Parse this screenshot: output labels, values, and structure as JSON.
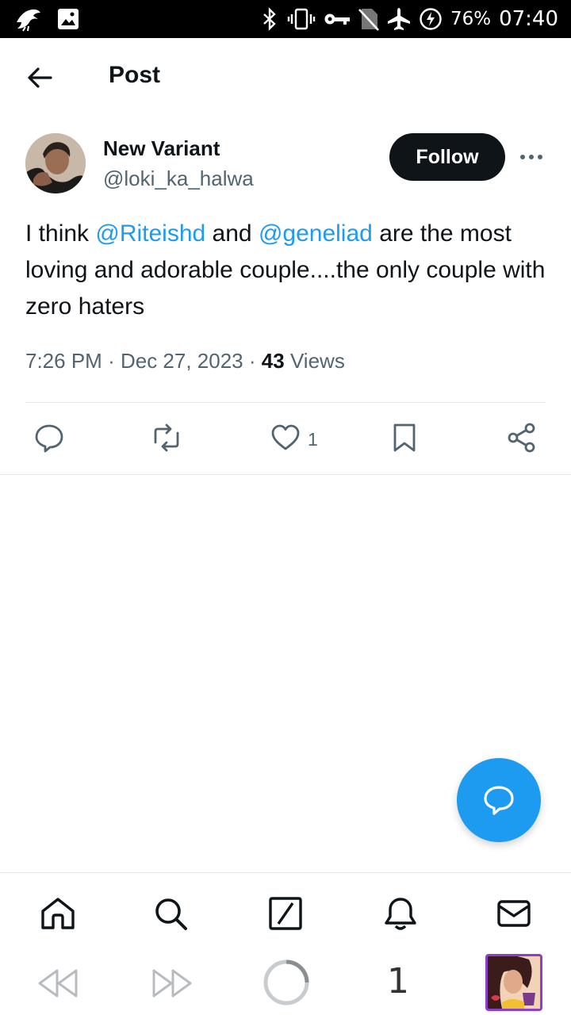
{
  "status_bar": {
    "battery_percent": "76%",
    "time": "07:40",
    "icons": [
      "bird-icon",
      "image-icon",
      "bluetooth-icon",
      "vibrate-icon",
      "key-icon",
      "no-sim-icon",
      "airplane-icon",
      "battery-saver-icon"
    ]
  },
  "header": {
    "title": "Post",
    "back_icon": "arrow-left-icon"
  },
  "post": {
    "author_name": "New Variant",
    "author_handle": "@loki_ka_halwa",
    "follow_label": "Follow",
    "text_parts": {
      "p1": "I think ",
      "m1": "@Riteishd",
      "p2": " and ",
      "m2": "@geneliad",
      "p3": " are the most loving and adorable couple....the only couple with zero haters"
    },
    "time": "7:26 PM",
    "date": "Dec 27, 2023",
    "separator": "·",
    "views_count": "43",
    "views_label": "Views"
  },
  "actions": {
    "reply_icon": "reply-icon",
    "repost_icon": "repost-icon",
    "like_icon": "heart-icon",
    "like_count": "1",
    "bookmark_icon": "bookmark-icon",
    "share_icon": "share-icon"
  },
  "fab": {
    "icon": "compose-reply-icon",
    "color": "#1d9bf0"
  },
  "bottom_nav": [
    "home-icon",
    "search-icon",
    "grok-icon",
    "notifications-icon",
    "messages-icon"
  ],
  "media_bar": {
    "counter": "1",
    "icons": [
      "rewind-icon",
      "fast-forward-icon",
      "loading-circle-icon",
      "media-thumbnail"
    ]
  },
  "colors": {
    "accent": "#1d9bf0",
    "text": "#0f1419",
    "secondary": "#536471",
    "thumbnail_border": "#8e3ec9"
  }
}
